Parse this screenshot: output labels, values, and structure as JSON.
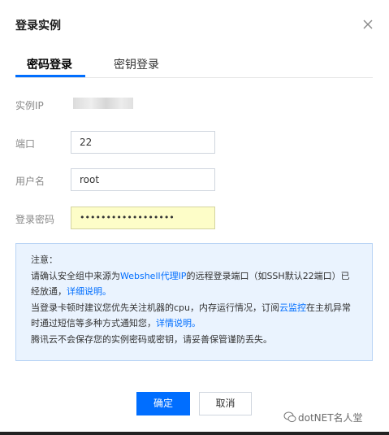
{
  "dialog": {
    "title": "登录实例",
    "close_icon": "close-icon"
  },
  "tabs": [
    {
      "label": "密码登录",
      "active": true
    },
    {
      "label": "密钥登录",
      "active": false
    }
  ],
  "form": {
    "ip_label": "实例IP",
    "port_label": "端口",
    "port_value": "22",
    "username_label": "用户名",
    "username_value": "root",
    "password_label": "登录密码",
    "password_value": "••••••••••••••••••"
  },
  "notice": {
    "heading": "注意：",
    "line1_pre": "请确认安全组中来源为",
    "line1_link": "Webshell代理IP",
    "line1_post": "的远程登录端口（如SSH默认22端口）已经放通，",
    "line1_link2": "详细说明。",
    "line2_pre": "当登录卡顿时建议您优先关注机器的cpu，内存运行情况，订阅",
    "line2_link": "云监控",
    "line2_post": "在主机异常时通过短信等多种方式通知您，",
    "line2_link2": "详情说明。",
    "line3": "腾讯云不会保存您的实例密码或密钥，请妥善保管谨防丢失。"
  },
  "buttons": {
    "confirm": "确定",
    "cancel": "取消"
  },
  "watermark": {
    "text": "dotNET名人堂",
    "icon": "wechat-icon"
  },
  "colors": {
    "accent": "#006eff",
    "notice_bg": "#eaf3fe",
    "password_bg": "#fdfdc8"
  }
}
